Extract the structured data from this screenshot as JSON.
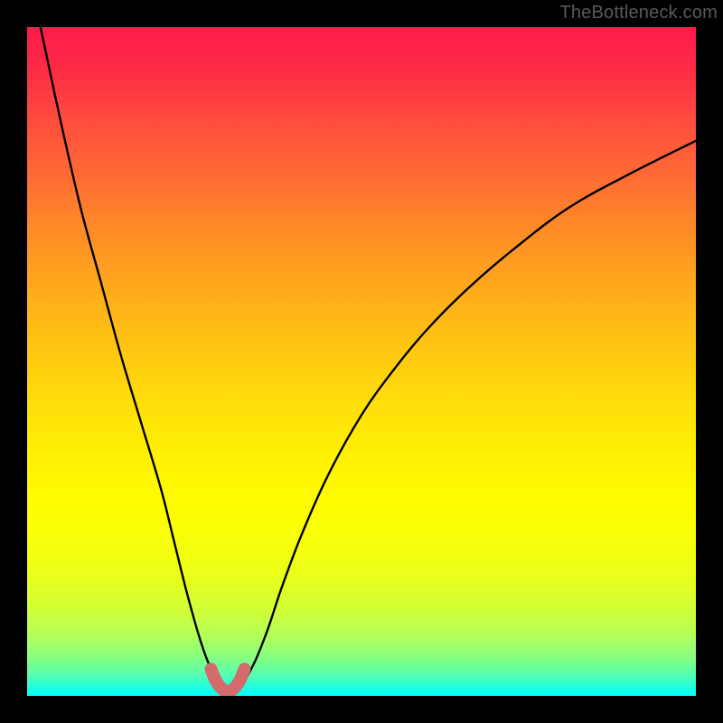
{
  "watermark": "TheBottleneck.com",
  "colors": {
    "page_bg": "#000000",
    "curve_stroke": "#000000",
    "marker_stroke": "#d36a6b",
    "gradient_top": "#fe1a4b",
    "gradient_bottom": "#06fdf9"
  },
  "chart_data": {
    "type": "line",
    "title": "",
    "xlabel": "",
    "ylabel": "",
    "xlim": [
      0,
      100
    ],
    "ylim": [
      0,
      100
    ],
    "grid": false,
    "annotations": [
      {
        "text": "TheBottleneck.com",
        "position": "top-right"
      }
    ],
    "series": [
      {
        "name": "bottleneck-curve",
        "x": [
          2,
          5,
          8,
          11,
          14,
          17,
          20,
          22,
          24,
          26,
          27.5,
          29,
          30,
          31,
          32,
          34,
          36,
          38,
          41,
          45,
          50,
          55,
          60,
          66,
          73,
          81,
          90,
          100
        ],
        "y": [
          100,
          86,
          73,
          62,
          51,
          41,
          31,
          23,
          15,
          8,
          4,
          1.5,
          0.6,
          0.6,
          1.5,
          5,
          10,
          16,
          24,
          33,
          42,
          49,
          55,
          61,
          67,
          73,
          78,
          83
        ]
      },
      {
        "name": "sweet-spot-markers",
        "x": [
          27.5,
          28.2,
          29,
          30,
          31,
          31.8,
          32.5
        ],
        "y": [
          4,
          2.3,
          1.2,
          0.6,
          1.2,
          2.3,
          4
        ]
      }
    ]
  }
}
